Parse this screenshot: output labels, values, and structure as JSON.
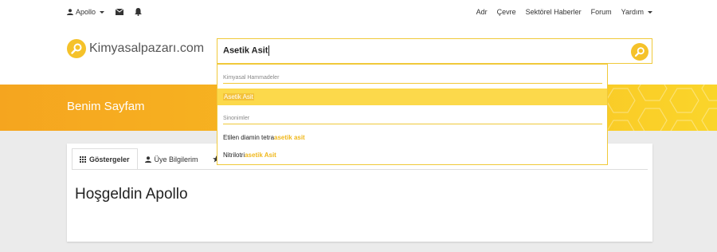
{
  "topbar": {
    "user_label": "Apollo",
    "right_links": [
      "Adr",
      "Çevre",
      "Sektörel Haberler",
      "Forum",
      "Yardım"
    ]
  },
  "header": {
    "logo_text": "Kimyasalpazarı.com"
  },
  "search": {
    "value": "Asetik Asit"
  },
  "dropdown": {
    "section1": "Kimyasal Hammadeler",
    "item1": "Asetik Asit",
    "section2": "Sinonimler",
    "item2_prefix": "Etilen diamin tetra ",
    "item2_match": "asetik asit",
    "item3_prefix": "Nitrilotri",
    "item3_match": "asetik Asit"
  },
  "banner": {
    "title": "Benim Sayfam"
  },
  "tabs": [
    {
      "label": "Göstergeler"
    },
    {
      "label": "Üye Bilgilerim"
    }
  ],
  "main": {
    "welcome": "Hoşgeldin Apollo"
  },
  "colors": {
    "accent": "#f5c22a",
    "banner_start": "#f5a51f",
    "banner_end": "#fad52a",
    "highlight": "#fcd94b"
  }
}
